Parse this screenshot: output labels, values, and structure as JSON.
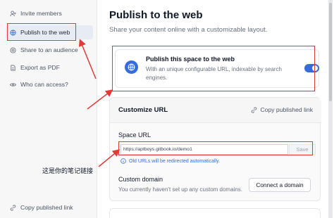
{
  "sidebar": {
    "items": [
      {
        "label": "Invite members",
        "icon": "invite-icon"
      },
      {
        "label": "Publish to the web",
        "icon": "globe-icon",
        "active": true
      },
      {
        "label": "Share to an audience",
        "icon": "audience-icon"
      },
      {
        "label": "Export as PDF",
        "icon": "document-icon"
      },
      {
        "label": "Who can access?",
        "icon": "eye-icon"
      }
    ],
    "copy_link": "Copy published link"
  },
  "main": {
    "title": "Publish to the web",
    "subtitle": "Share your content online with a customizable layout.",
    "publish_card": {
      "title": "Publish this space to the web",
      "description": "With an unique configurable URL, indexable by search engines.",
      "toggle_on": true
    },
    "custom_url": {
      "title": "Customize URL",
      "copy_link": "Copy published link",
      "space_url_label": "Space URL",
      "space_url_value": "https://aptboys.gitbook.io/demo1",
      "save_label": "Save",
      "info_text": "Old URLs will be redirected automatically.",
      "custom_domain_label": "Custom domain",
      "custom_domain_desc": "You currently haven't set up any custom domains.",
      "connect_label": "Connect a domain"
    }
  },
  "annotation": {
    "note": "这是你的笔记链接",
    "color": "#e53935"
  },
  "colors": {
    "accent": "#346ddb"
  }
}
